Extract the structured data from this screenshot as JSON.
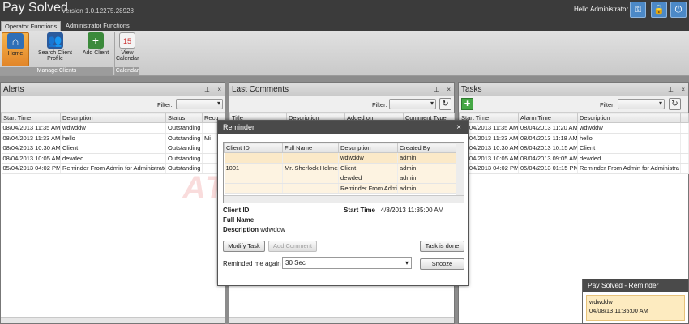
{
  "app": {
    "title": "Pay Solved",
    "version": "Version 1.0.12275.28928",
    "greeting": "Hello Administrator"
  },
  "titlebar_icons": [
    "key-icon",
    "lock-icon",
    "power-icon"
  ],
  "ribbon_tabs": [
    "Operator Functions",
    "Administrator Functions"
  ],
  "ribbon": {
    "buttons": {
      "home": "Home",
      "search": "Search Client Profile",
      "add_client": "Add Client",
      "calendar": "View Calendar"
    },
    "groups": {
      "manage": "Manage Clients",
      "calendar": "Calendar"
    }
  },
  "alerts": {
    "title": "Alerts",
    "filter_label": "Filter:",
    "columns": [
      "Start Time",
      "Description",
      "Status",
      "Recu"
    ],
    "rows": [
      [
        "08/04/2013 11:35 AM",
        "wdwddw",
        "Outstanding",
        ""
      ],
      [
        "08/04/2013 11:33 AM",
        "hello",
        "Outstanding",
        "Mi"
      ],
      [
        "08/04/2013 10:30 AM",
        "Client",
        "Outstanding",
        ""
      ],
      [
        "08/04/2013 10:05 AM",
        "dewded",
        "Outstanding",
        ""
      ],
      [
        "05/04/2013 04:02 PM",
        "Reminder From Admin for Administrator",
        "Outstanding",
        ""
      ]
    ]
  },
  "comments": {
    "title": "Last Comments",
    "filter_label": "Filter:",
    "columns": [
      "Title",
      "Description",
      "Added on",
      "Comment Type"
    ]
  },
  "tasks": {
    "title": "Tasks",
    "filter_label": "Filter:",
    "columns": [
      "Start Time",
      "Alarm Time",
      "Description"
    ],
    "rows": [
      [
        "08/04/2013 11:35 AM",
        "08/04/2013 11:20 AM",
        "wdwddw"
      ],
      [
        "08/04/2013 11:33 AM",
        "08/04/2013 11:18 AM",
        "hello"
      ],
      [
        "08/04/2013 10:30 AM",
        "08/04/2013 10:15 AM",
        "Client"
      ],
      [
        "08/04/2013 10:05 AM",
        "08/04/2013 09:05 AM",
        "dewded"
      ],
      [
        "05/04/2013 04:02 PM",
        "05/04/2013 01:15 PM",
        "Reminder From Admin for Administra"
      ]
    ]
  },
  "reminder": {
    "title": "Reminder",
    "columns": [
      "Client ID",
      "Full Name",
      "Description",
      "Created By"
    ],
    "rows": [
      [
        "",
        "",
        "wdwddw",
        "admin"
      ],
      [
        "1001",
        "Mr. Sherlock Holmes",
        "Client",
        "admin"
      ],
      [
        "",
        "",
        "dewded",
        "admin"
      ],
      [
        "",
        "",
        "Reminder From Admin",
        "admin"
      ]
    ],
    "client_id_label": "Client ID",
    "full_name_label": "Full Name",
    "description_label": "Description",
    "description_value": "wdwddw",
    "start_time_label": "Start Time",
    "start_time_value": "4/8/2013 11:35:00 AM",
    "modify_task": "Modify Task",
    "add_comment": "Add Comment",
    "task_done": "Task is done",
    "remind_label": "Reminded me again in",
    "remind_value": "30 Sec",
    "snooze": "Snooze"
  },
  "toast": {
    "title": "Pay Solved - Reminder",
    "line1": "wdwddw",
    "line2": "04/08/13 11:35:00 AM"
  },
  "watermark": "ATDRIVE"
}
